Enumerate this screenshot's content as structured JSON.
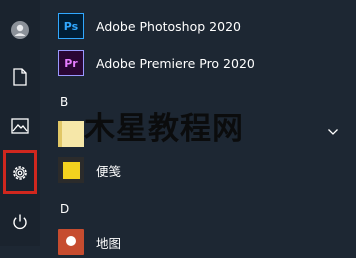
{
  "rail": {
    "items": [
      "avatar-icon",
      "document-icon",
      "pictures-icon",
      "settings-icon",
      "power-icon"
    ]
  },
  "apps": [
    {
      "label": "Adobe Photoshop 2020",
      "icon_text": "Ps",
      "icon_bg": "#001e36",
      "icon_fg": "#31a8ff",
      "icon_border": "#31a8ff"
    },
    {
      "label": "Adobe Premiere Pro 2020",
      "icon_text": "Pr",
      "icon_bg": "#2a0634",
      "icon_fg": "#e77cff",
      "icon_border": "#9999ff"
    }
  ],
  "sections": {
    "b": "B",
    "d": "D"
  },
  "group_b": {
    "folder_label": "木星教程网",
    "sticky_notes_label": "便笺"
  },
  "group_d": {
    "maps_label": "地图"
  },
  "colors": {
    "highlight": "#d0271e",
    "background": "#1d2733",
    "folder_tile": "#f6e7a8",
    "sticky_tile": "#f3d21f"
  }
}
